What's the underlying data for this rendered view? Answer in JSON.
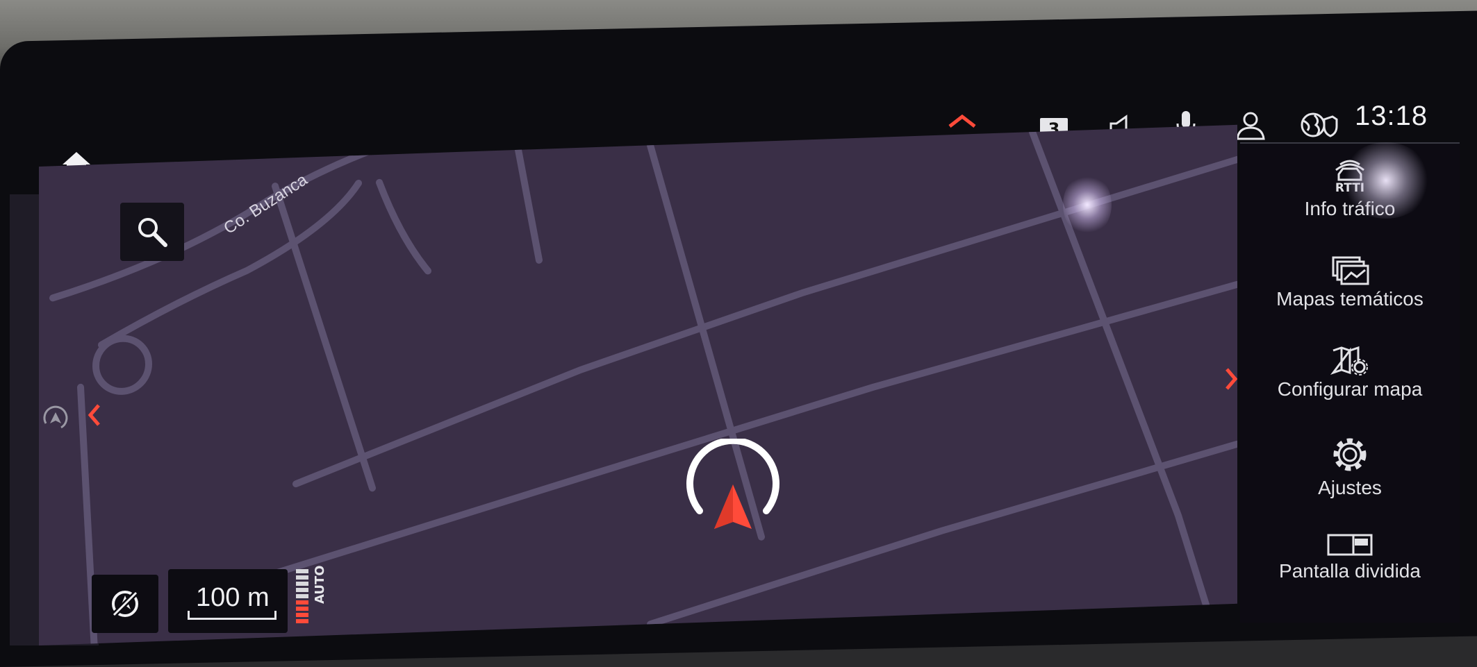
{
  "status_bar": {
    "badge": "3",
    "time": "13:18",
    "icons": [
      "chevron-up-icon",
      "speaker-icon",
      "microphone-icon",
      "profile-icon",
      "globe-shield-icon"
    ]
  },
  "map": {
    "street_label": "Co. Buzanca",
    "scale": "100 m",
    "zoom_mode": "AUTO"
  },
  "side_menu": {
    "items": [
      {
        "label": "Info tráfico",
        "sub": "RTTI",
        "icon": "traffic-car-icon"
      },
      {
        "label": "Mapas temáticos",
        "icon": "layered-map-icon"
      },
      {
        "label": "Configurar mapa",
        "icon": "map-settings-icon"
      },
      {
        "label": "Ajustes",
        "icon": "gear-icon"
      },
      {
        "label": "Pantalla dividida",
        "icon": "split-screen-icon"
      }
    ]
  },
  "colors": {
    "accent": "#ff4b3a",
    "map_bg": "#3a2f47",
    "road": "#5c5270",
    "menu_bg": "#0d0b13"
  }
}
